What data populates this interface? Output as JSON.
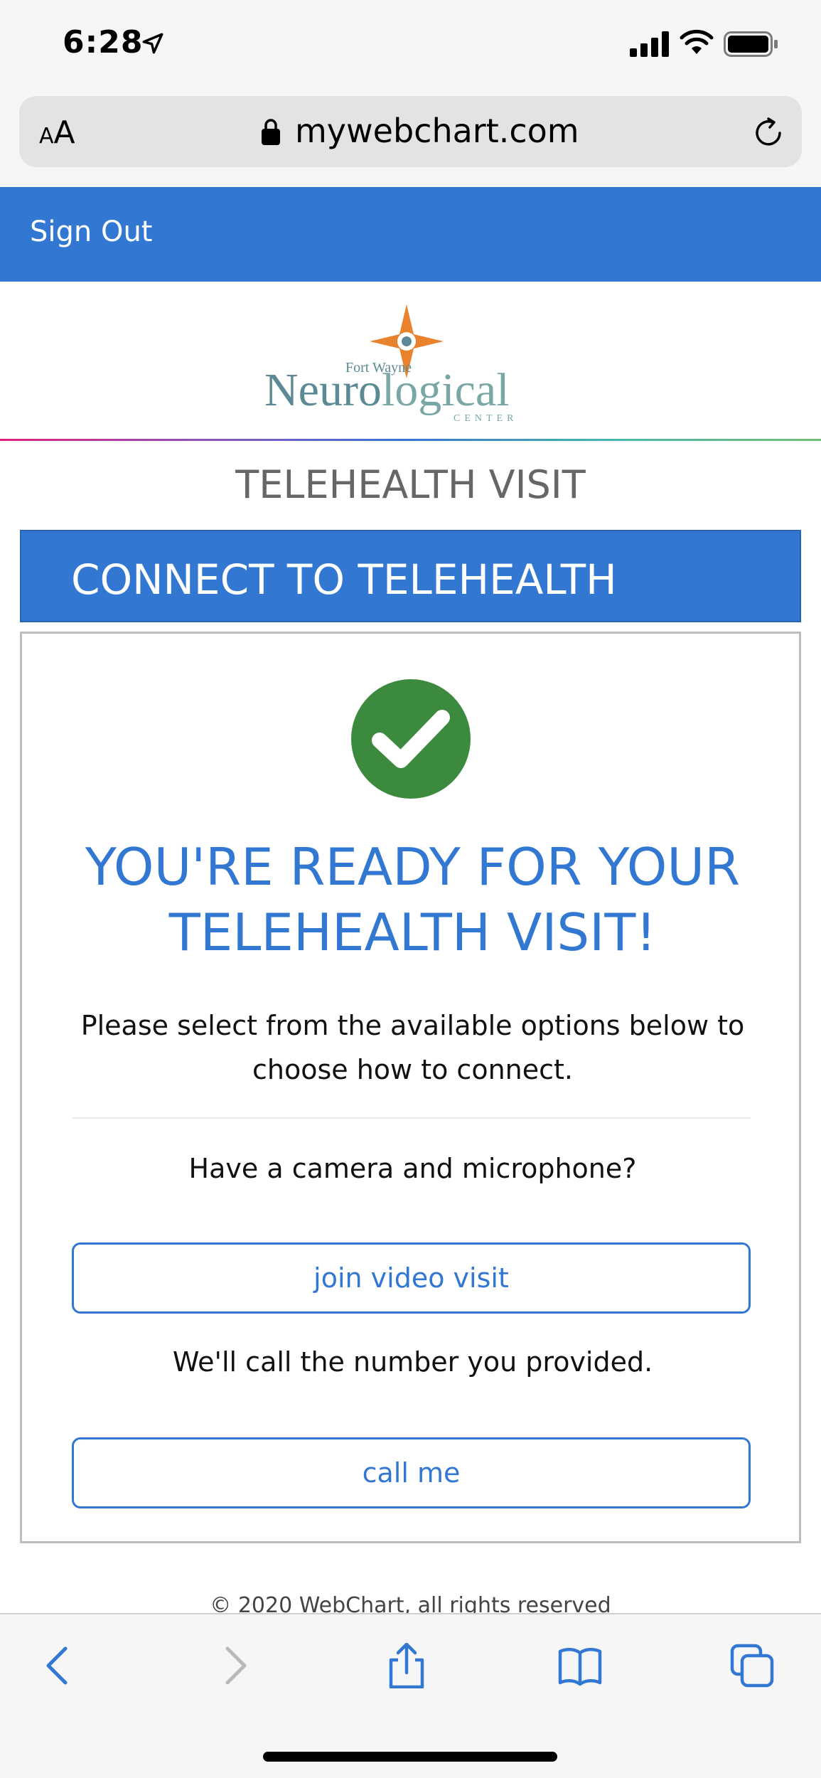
{
  "status_bar": {
    "time": "6:28"
  },
  "browser": {
    "text_size_label_small": "A",
    "text_size_label_large": "A",
    "url": "mywebchart.com"
  },
  "nav": {
    "sign_out": "Sign Out"
  },
  "logo": {
    "top_text": "Fort Wayne",
    "main_text_1": "Neuro",
    "main_text_2": "logical",
    "sub_text": "CENTER"
  },
  "page": {
    "section_title": "TELEHEALTH VISIT",
    "panel_header": "CONNECT TO TELEHEALTH",
    "ready_line1": "YOU'RE READY FOR YOUR",
    "ready_line2": "TELEHEALTH VISIT!",
    "instructions": "Please select from the available options below to choose how to connect.",
    "camera_question": "Have a camera and microphone?",
    "video_button": "join video visit",
    "call_info": "We'll call the number you provided.",
    "call_button": "call me",
    "footer": "© 2020 WebChart, all rights reserved"
  },
  "colors": {
    "accent": "#3278d3",
    "success": "#3b8a3e",
    "logo_orange": "#e8822c",
    "logo_teal": "#5b8a94"
  },
  "icons": [
    "location-arrow-icon",
    "signal-icon",
    "wifi-icon",
    "battery-icon",
    "lock-icon",
    "reload-icon",
    "checkmark-icon",
    "back-icon",
    "forward-icon",
    "share-icon",
    "bookmarks-icon",
    "tabs-icon"
  ]
}
